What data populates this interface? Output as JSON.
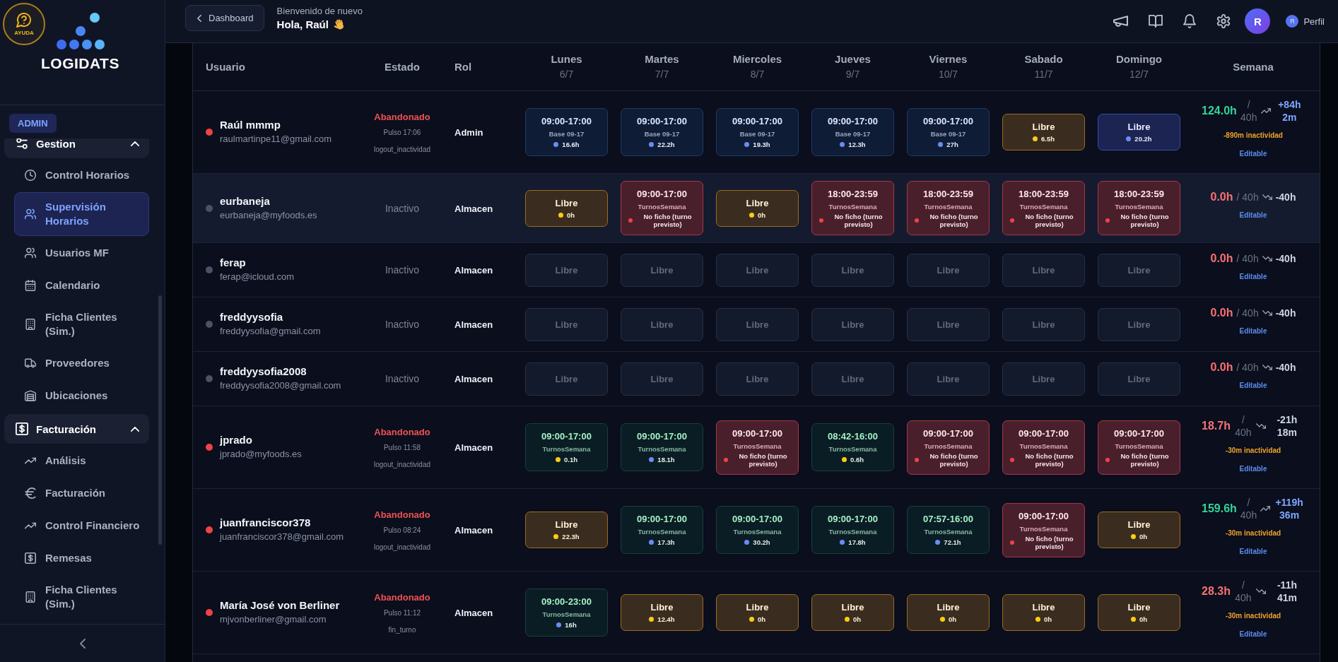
{
  "sidebar": {
    "help_label": "AYUDA",
    "logo_text": "LOGIDATS",
    "role_badge": "ADMIN",
    "groups": [
      {
        "label": "Gestion",
        "expanded": true,
        "children": [
          {
            "label": "Control Horarios",
            "selected": false
          },
          {
            "label": "Supervisión Horarios",
            "selected": true
          },
          {
            "label": "Usuarios MF",
            "selected": false
          },
          {
            "label": "Calendario",
            "selected": false
          },
          {
            "label": "Ficha Clientes (Sim.)",
            "selected": false
          },
          {
            "label": "Proveedores",
            "selected": false
          },
          {
            "label": "Ubicaciones",
            "selected": false
          }
        ]
      },
      {
        "label": "Facturación",
        "expanded": true,
        "children": [
          {
            "label": "Análisis",
            "selected": false
          },
          {
            "label": "Facturación",
            "selected": false
          },
          {
            "label": "Control Financiero",
            "selected": false
          },
          {
            "label": "Remesas",
            "selected": false
          },
          {
            "label": "Ficha Clientes (Sim.)",
            "selected": false
          }
        ]
      }
    ]
  },
  "header": {
    "back_button": "Dashboard",
    "greeting": "Bienvenido de nuevo",
    "title": "Hola, Raúl",
    "avatar_initial": "R",
    "profile": {
      "initial": "R",
      "label": "Perfil"
    }
  },
  "table": {
    "columns": [
      {
        "label": "Usuario"
      },
      {
        "label": "Estado"
      },
      {
        "label": "Rol"
      },
      {
        "label": "Lunes",
        "date": "6/7"
      },
      {
        "label": "Martes",
        "date": "7/7"
      },
      {
        "label": "Miercoles",
        "date": "8/7"
      },
      {
        "label": "Jueves",
        "date": "9/7"
      },
      {
        "label": "Viernes",
        "date": "10/7"
      },
      {
        "label": "Sabado",
        "date": "11/7"
      },
      {
        "label": "Domingo",
        "date": "12/7"
      },
      {
        "label": "Semana"
      }
    ],
    "rows": [
      {
        "name": "Raúl mmmp",
        "email": "raulmartinpe11@gmail.com",
        "color": "#ef4444",
        "highlighted": false,
        "status": {
          "kind": "alert",
          "label": "Abandonado",
          "pulse": "Pulso 17:06",
          "reason": "logout_inactividad"
        },
        "role": "Admin",
        "days": [
          {
            "kind": "navy",
            "time": "09:00-17:00",
            "source": "Base 09-17",
            "color": "#6b8cf5",
            "detail": "16.6h"
          },
          {
            "kind": "navy",
            "time": "09:00-17:00",
            "source": "Base 09-17",
            "color": "#6b8cf5",
            "detail": "22.2h"
          },
          {
            "kind": "navy",
            "time": "09:00-17:00",
            "source": "Base 09-17",
            "color": "#6b8cf5",
            "detail": "19.3h"
          },
          {
            "kind": "navy",
            "time": "09:00-17:00",
            "source": "Base 09-17",
            "color": "#6b8cf5",
            "detail": "12.3h"
          },
          {
            "kind": "navy",
            "time": "09:00-17:00",
            "source": "Base 09-17",
            "color": "#6b8cf5",
            "detail": "27h"
          },
          {
            "kind": "amber",
            "label": "Libre",
            "color": "#facc15",
            "detail": "6.5h"
          },
          {
            "kind": "indigo",
            "label": "Libre",
            "color": "#6b8cf5",
            "detail": "20.2h"
          }
        ],
        "week": {
          "kind": "up",
          "total": "124.0h",
          "target": "/ 40h",
          "difference": "+84h 2m",
          "inactivity": "-890m inactividad",
          "link": "Editable"
        }
      },
      {
        "name": "eurbaneja",
        "email": "eurbaneja@myfoods.es",
        "color": "#4b5263",
        "highlighted": true,
        "status": {
          "kind": "idle",
          "label": "Inactivo"
        },
        "role": "Almacen",
        "days": [
          {
            "kind": "amber",
            "label": "Libre",
            "color": "#facc15",
            "detail": "0h"
          },
          {
            "kind": "red",
            "time": "09:00-17:00",
            "source": "TurnosSemana",
            "color": "#ef4444",
            "detail": "No ficho (turno previsto)"
          },
          {
            "kind": "amber",
            "label": "Libre",
            "color": "#facc15",
            "detail": "0h"
          },
          {
            "kind": "red",
            "time": "18:00-23:59",
            "source": "TurnosSemana",
            "color": "#ef4444",
            "detail": "No ficho (turno previsto)"
          },
          {
            "kind": "red",
            "time": "18:00-23:59",
            "source": "TurnosSemana",
            "color": "#ef4444",
            "detail": "No ficho (turno previsto)"
          },
          {
            "kind": "red",
            "time": "18:00-23:59",
            "source": "TurnosSemana",
            "color": "#ef4444",
            "detail": "No ficho (turno previsto)"
          },
          {
            "kind": "red",
            "time": "18:00-23:59",
            "source": "TurnosSemana",
            "color": "#ef4444",
            "detail": "No ficho (turno previsto)"
          }
        ],
        "week": {
          "kind": "down",
          "total": "0.0h",
          "target": "/ 40h",
          "difference": "-40h",
          "link": "Editable"
        }
      },
      {
        "name": "ferap",
        "email": "ferap@icloud.com",
        "color": "#4b5263",
        "highlighted": false,
        "status": {
          "kind": "idle",
          "label": "Inactivo"
        },
        "role": "Almacen",
        "days": [
          {
            "kind": "blank",
            "label": "Libre"
          },
          {
            "kind": "blank",
            "label": "Libre"
          },
          {
            "kind": "blank",
            "label": "Libre"
          },
          {
            "kind": "blank",
            "label": "Libre"
          },
          {
            "kind": "blank",
            "label": "Libre"
          },
          {
            "kind": "blank",
            "label": "Libre"
          },
          {
            "kind": "blank",
            "label": "Libre"
          }
        ],
        "week": {
          "kind": "down",
          "total": "0.0h",
          "target": "/ 40h",
          "difference": "-40h",
          "link": "Editable"
        }
      },
      {
        "name": "freddyysofia",
        "email": "freddyysofia@gmail.com",
        "color": "#4b5263",
        "highlighted": false,
        "status": {
          "kind": "idle",
          "label": "Inactivo"
        },
        "role": "Almacen",
        "days": [
          {
            "kind": "blank",
            "label": "Libre"
          },
          {
            "kind": "blank",
            "label": "Libre"
          },
          {
            "kind": "blank",
            "label": "Libre"
          },
          {
            "kind": "blank",
            "label": "Libre"
          },
          {
            "kind": "blank",
            "label": "Libre"
          },
          {
            "kind": "blank",
            "label": "Libre"
          },
          {
            "kind": "blank",
            "label": "Libre"
          }
        ],
        "week": {
          "kind": "down",
          "total": "0.0h",
          "target": "/ 40h",
          "difference": "-40h",
          "link": "Editable"
        }
      },
      {
        "name": "freddyysofia2008",
        "email": "freddyysofia2008@gmail.com",
        "color": "#4b5263",
        "highlighted": false,
        "status": {
          "kind": "idle",
          "label": "Inactivo"
        },
        "role": "Almacen",
        "days": [
          {
            "kind": "blank",
            "label": "Libre"
          },
          {
            "kind": "blank",
            "label": "Libre"
          },
          {
            "kind": "blank",
            "label": "Libre"
          },
          {
            "kind": "blank",
            "label": "Libre"
          },
          {
            "kind": "blank",
            "label": "Libre"
          },
          {
            "kind": "blank",
            "label": "Libre"
          },
          {
            "kind": "blank",
            "label": "Libre"
          }
        ],
        "week": {
          "kind": "down",
          "total": "0.0h",
          "target": "/ 40h",
          "difference": "-40h",
          "link": "Editable"
        }
      },
      {
        "name": "jprado",
        "email": "jprado@myfoods.es",
        "color": "#ef4444",
        "highlighted": false,
        "status": {
          "kind": "alert",
          "label": "Abandonado",
          "pulse": "Pulso 11:58",
          "reason": "logout_inactividad"
        },
        "role": "Almacen",
        "days": [
          {
            "kind": "teal",
            "time": "09:00-17:00",
            "source": "TurnosSemana",
            "color": "#facc15",
            "detail": "0.1h"
          },
          {
            "kind": "teal",
            "time": "09:00-17:00",
            "source": "TurnosSemana",
            "color": "#6b8cf5",
            "detail": "18.1h"
          },
          {
            "kind": "red",
            "time": "09:00-17:00",
            "source": "TurnosSemana",
            "color": "#ef4444",
            "detail": "No ficho (turno previsto)"
          },
          {
            "kind": "teal",
            "time": "08:42-16:00",
            "source": "TurnosSemana",
            "color": "#facc15",
            "detail": "0.6h"
          },
          {
            "kind": "red",
            "time": "09:00-17:00",
            "source": "TurnosSemana",
            "color": "#ef4444",
            "detail": "No ficho (turno previsto)"
          },
          {
            "kind": "red",
            "time": "09:00-17:00",
            "source": "TurnosSemana",
            "color": "#ef4444",
            "detail": "No ficho (turno previsto)"
          },
          {
            "kind": "red",
            "time": "09:00-17:00",
            "source": "TurnosSemana",
            "color": "#ef4444",
            "detail": "No ficho (turno previsto)"
          }
        ],
        "week": {
          "kind": "down",
          "total": "18.7h",
          "target": "/ 40h",
          "difference": "-21h 18m",
          "inactivity": "-30m inactividad",
          "link": "Editable"
        }
      },
      {
        "name": "juanfranciscor378",
        "email": "juanfranciscor378@gmail.com",
        "color": "#ef4444",
        "highlighted": false,
        "status": {
          "kind": "alert",
          "label": "Abandonado",
          "pulse": "Pulso 08:24",
          "reason": "logout_inactividad"
        },
        "role": "Almacen",
        "days": [
          {
            "kind": "amber",
            "label": "Libre",
            "color": "#facc15",
            "detail": "22.3h"
          },
          {
            "kind": "teal",
            "time": "09:00-17:00",
            "source": "TurnosSemana",
            "color": "#6b8cf5",
            "detail": "17.3h"
          },
          {
            "kind": "teal",
            "time": "09:00-17:00",
            "source": "TurnosSemana",
            "color": "#6b8cf5",
            "detail": "30.2h"
          },
          {
            "kind": "teal",
            "time": "09:00-17:00",
            "source": "TurnosSemana",
            "color": "#6b8cf5",
            "detail": "17.8h"
          },
          {
            "kind": "teal",
            "time": "07:57-16:00",
            "source": "TurnosSemana",
            "color": "#6b8cf5",
            "detail": "72.1h"
          },
          {
            "kind": "red",
            "time": "09:00-17:00",
            "source": "TurnosSemana",
            "color": "#ef4444",
            "detail": "No ficho (turno previsto)"
          },
          {
            "kind": "amber",
            "label": "Libre",
            "color": "#facc15",
            "detail": "0h"
          }
        ],
        "week": {
          "kind": "up",
          "total": "159.6h",
          "target": "/ 40h",
          "difference": "+119h 36m",
          "inactivity": "-30m inactividad",
          "link": "Editable"
        }
      },
      {
        "name": "María José von Berliner",
        "email": "mjvonberliner@gmail.com",
        "color": "#ef4444",
        "highlighted": false,
        "status": {
          "kind": "alert",
          "label": "Abandonado",
          "pulse": "Pulso 11:12",
          "reason": "fin_turno"
        },
        "role": "Almacen",
        "days": [
          {
            "kind": "teal",
            "time": "09:00-23:00",
            "source": "TurnosSemana",
            "color": "#6b8cf5",
            "detail": "16h"
          },
          {
            "kind": "amber",
            "label": "Libre",
            "color": "#facc15",
            "detail": "12.4h"
          },
          {
            "kind": "amber",
            "label": "Libre",
            "color": "#facc15",
            "detail": "0h"
          },
          {
            "kind": "amber",
            "label": "Libre",
            "color": "#facc15",
            "detail": "0h"
          },
          {
            "kind": "amber",
            "label": "Libre",
            "color": "#facc15",
            "detail": "0h"
          },
          {
            "kind": "amber",
            "label": "Libre",
            "color": "#facc15",
            "detail": "0h"
          },
          {
            "kind": "amber",
            "label": "Libre",
            "color": "#facc15",
            "detail": "0h"
          }
        ],
        "week": {
          "kind": "down",
          "total": "28.3h",
          "target": "/ 40h",
          "difference": "-11h 41m",
          "inactivity": "-30m inactividad",
          "link": "Editable"
        }
      }
    ]
  }
}
